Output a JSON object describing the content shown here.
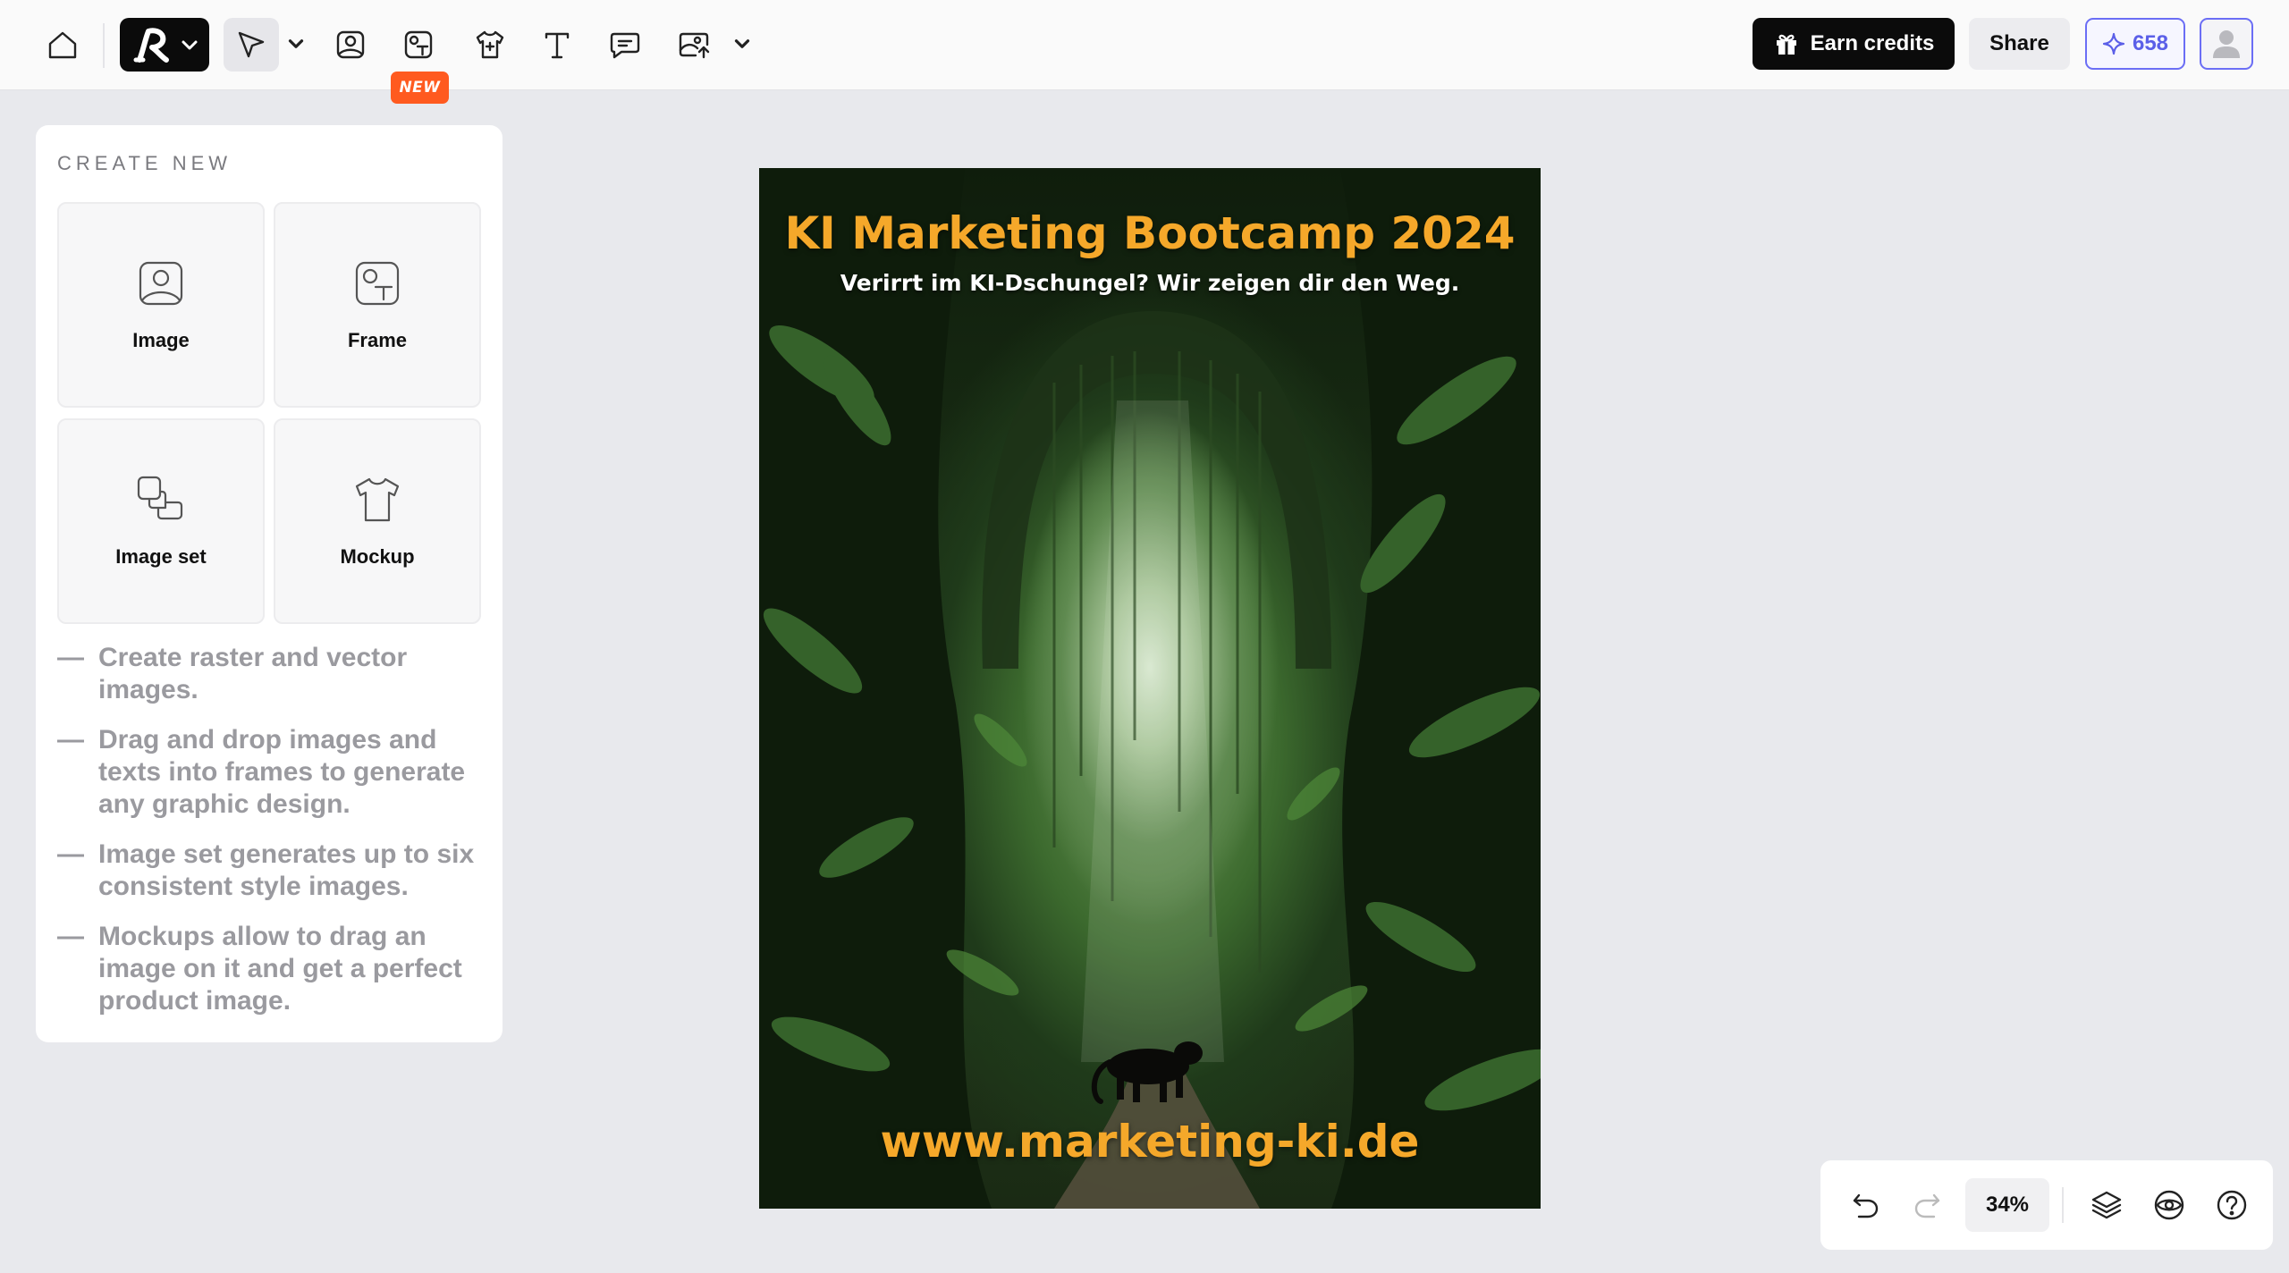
{
  "toolbar": {
    "new_badge": "NEW",
    "earn_credits_label": "Earn credits",
    "share_label": "Share",
    "credits_count": "658",
    "icons": [
      "home-icon",
      "logo-menu",
      "select-tool-icon",
      "image-tool-icon",
      "frame-tool-icon",
      "mockup-tool-icon",
      "text-tool-icon",
      "comment-tool-icon",
      "upload-tool-icon"
    ]
  },
  "panel": {
    "title": "CREATE NEW",
    "tiles": [
      {
        "label": "Image",
        "icon": "image-icon"
      },
      {
        "label": "Frame",
        "icon": "frame-icon"
      },
      {
        "label": "Image set",
        "icon": "image-set-icon"
      },
      {
        "label": "Mockup",
        "icon": "tshirt-icon"
      }
    ],
    "tip_dash": "—",
    "tips": [
      "Create raster and vector images.",
      "Drag and drop images and texts into frames to generate any graphic design.",
      "Image set generates up to six consistent style images.",
      "Mockups allow to drag an image on it and get a perfect product image."
    ]
  },
  "artwork": {
    "title": "KI Marketing Bootcamp 2024",
    "subtitle": "Verirrt im KI-Dschungel? Wir zeigen dir den Weg.",
    "url": "www.marketing-ki.de"
  },
  "controls": {
    "zoom": "34%"
  },
  "colors": {
    "accent": "#6b6ef5",
    "new_badge": "#ff5a1f",
    "poster_text": "#f5a82a"
  }
}
